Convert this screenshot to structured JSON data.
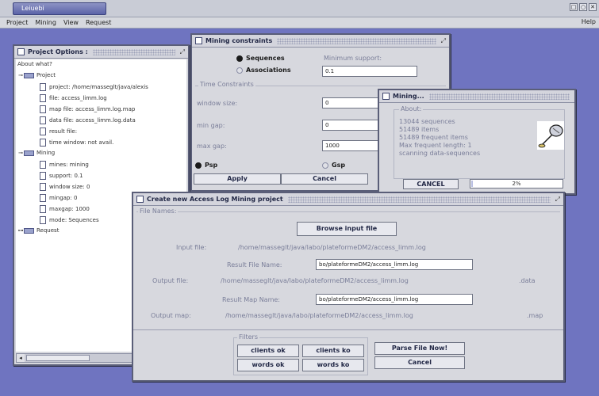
{
  "app": {
    "title": "Leiuebi"
  },
  "window_controls": [
    "□",
    "○",
    "✕"
  ],
  "menubar": {
    "items": [
      "Project",
      "Mining",
      "View",
      "Request"
    ],
    "help": "Help"
  },
  "project_options": {
    "title": "Project Options :",
    "tree": [
      {
        "label": "About what?",
        "type": "root",
        "level": 0
      },
      {
        "label": "Project",
        "type": "folder",
        "level": 0
      },
      {
        "label": "project: /home/masseglt/java/alexis",
        "type": "file",
        "level": 1
      },
      {
        "label": "file: access_limm.log",
        "type": "file",
        "level": 1
      },
      {
        "label": "map file: access_limm.log.map",
        "type": "file",
        "level": 1
      },
      {
        "label": "data file: access_limm.log.data",
        "type": "file",
        "level": 1
      },
      {
        "label": "result file:",
        "type": "file",
        "level": 1
      },
      {
        "label": "time window: not avail.",
        "type": "file",
        "level": 1
      },
      {
        "label": "Mining",
        "type": "folder",
        "level": 0
      },
      {
        "label": "mines: mining",
        "type": "file",
        "level": 1
      },
      {
        "label": "support: 0.1",
        "type": "file",
        "level": 1
      },
      {
        "label": "window size: 0",
        "type": "file",
        "level": 1
      },
      {
        "label": "mingap: 0",
        "type": "file",
        "level": 1
      },
      {
        "label": "maxgap: 1000",
        "type": "file",
        "level": 1
      },
      {
        "label": "mode: Sequences",
        "type": "file",
        "level": 1
      },
      {
        "label": "Request",
        "type": "folder",
        "level": 0
      }
    ]
  },
  "mining_constraints": {
    "title": "Mining constraints",
    "mode_options": [
      "Sequences",
      "Associations"
    ],
    "min_support_label": "Minimum support:",
    "min_support_value": "0.1",
    "time_constraints_label": "Time Constraints",
    "window_size_label": "window size:",
    "window_size_value": "0",
    "min_gap_label": "min gap:",
    "min_gap_value": "0",
    "max_gap_label": "max gap:",
    "max_gap_value": "1000",
    "psp_label": "Psp",
    "gsp_label": "Gsp",
    "apply": "Apply",
    "cancel": "Cancel"
  },
  "mining_progress": {
    "title": "Mining...",
    "about_label": "About:",
    "stats": [
      "13044 sequences",
      "51489 items",
      "51489 frequent items",
      "Max frequent length: 1",
      "scanning data-sequences"
    ],
    "cancel": "CANCEL",
    "progress_percent": 2,
    "progress_text": "2%"
  },
  "access_log": {
    "title": "Create new Access Log Mining project",
    "file_names_label": "File Names:",
    "browse_button": "Browse input file",
    "input_label": "Input file:",
    "input_value": "/home/masseglt/java/labo/plateformeDM2/access_limm.log",
    "result_label": "Result File Name:",
    "result_value": "bo/plateformeDM2/access_limm.log",
    "output_label": "Output file:",
    "output_value": "/home/masseglt/java/labo/plateformeDM2/access_limm.log",
    "output_ext": ".data",
    "result_map_label": "Result Map Name:",
    "result_map_value": "bo/plateformeDM2/access_limm.log",
    "output_map_label": "Output map:",
    "output_map_value": "/home/masseglt/java/labo/plateformeDM2/access_limm.log",
    "output_map_ext": ".map",
    "filters_label": "Filters",
    "filters": [
      "clients ok",
      "clients ko",
      "words ok",
      "words ko"
    ],
    "parse_button": "Parse File Now!",
    "cancel_button": "Cancel"
  }
}
